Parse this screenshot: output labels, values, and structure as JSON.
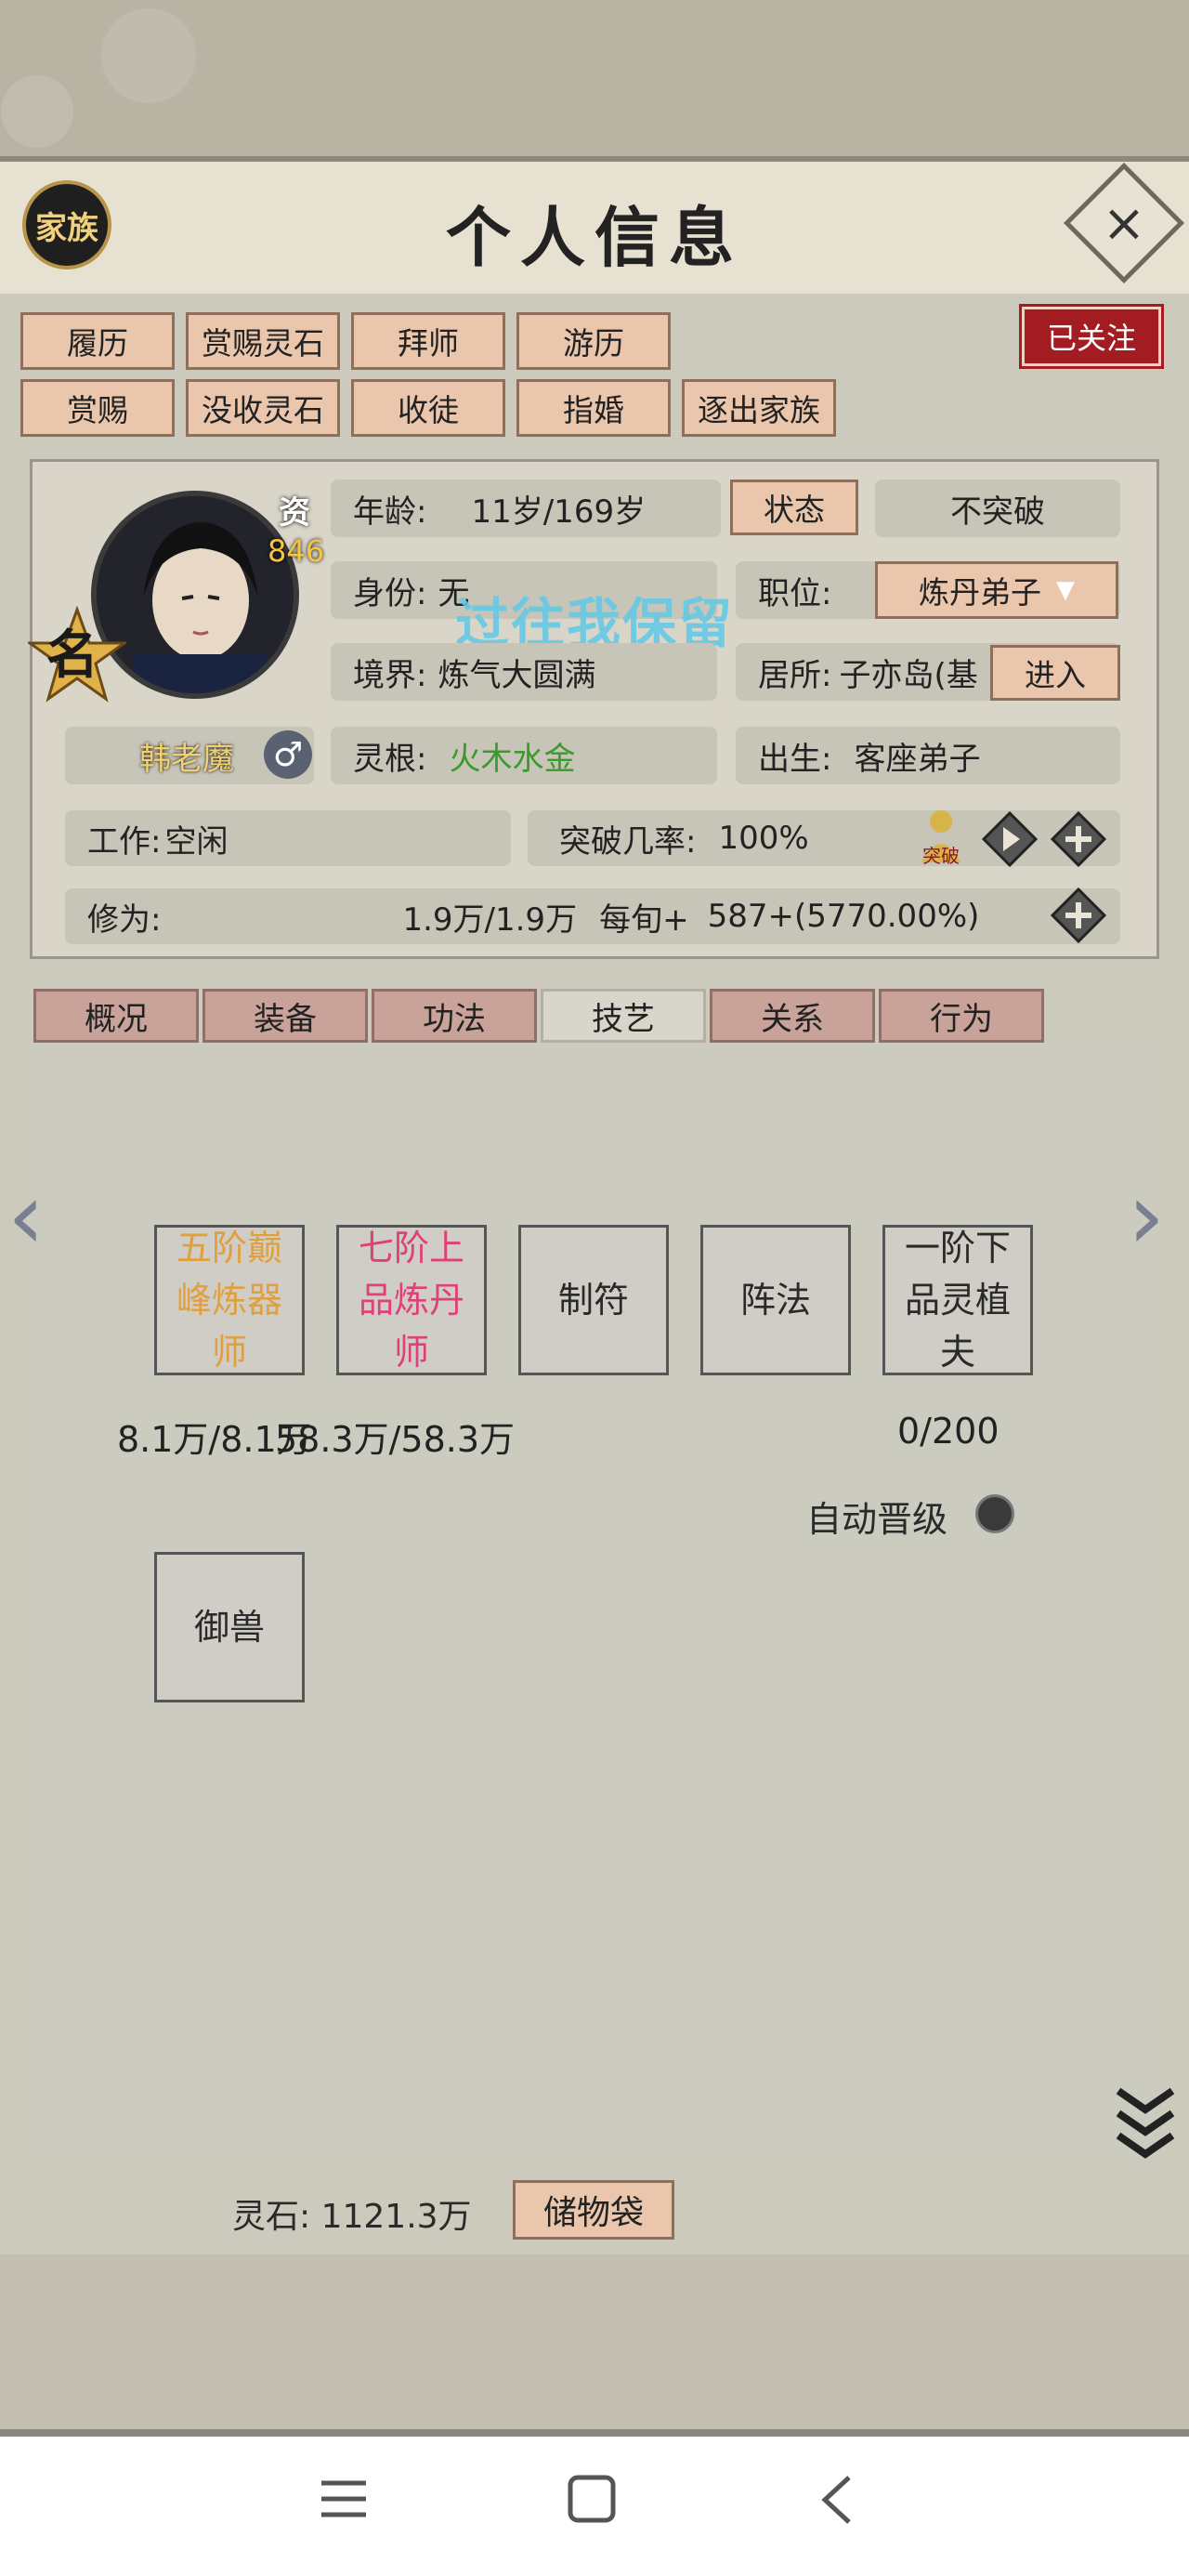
{
  "header": {
    "title": "个人信息",
    "family_label": "家族",
    "close": "×"
  },
  "actions_row1": [
    "履历",
    "赏赐灵石",
    "拜师",
    "游历"
  ],
  "actions_row2": [
    "赏赐",
    "没收灵石",
    "收徒",
    "指婚",
    "逐出家族"
  ],
  "follow_label": "已关注",
  "profile": {
    "aptitude_label": "资",
    "aptitude_value": "846",
    "rank_badge": "名",
    "name": "韩老魔",
    "gender_symbol": "♂",
    "age_label": "年龄:",
    "age_value": "11岁/169岁",
    "status_button": "状态",
    "breakthrough_button": "不突破",
    "identity_label": "身份:",
    "identity_value": "无",
    "watermark": "过往我保留",
    "position_label": "职位:",
    "position_value": "炼丹弟子",
    "realm_label": "境界:",
    "realm_value": "炼气大圆满",
    "residence_label": "居所:",
    "residence_value": "子亦岛(基",
    "enter_button": "进入",
    "root_label": "灵根:",
    "root_value": "火木水金",
    "birth_label": "出生:",
    "birth_value": "客座弟子",
    "work_label": "工作:",
    "work_value": "空闲",
    "break_rate_label": "突破几率:",
    "break_rate_value": "100%",
    "break_icon_text": "突破",
    "cultivation_label": "修为:",
    "cultivation_value": "1.9万/1.9万",
    "per_round_label": "每旬+",
    "per_round_value": "587+(5770.00%)"
  },
  "tabs": [
    "概况",
    "装备",
    "功法",
    "技艺",
    "关系",
    "行为"
  ],
  "active_tab": "技艺",
  "skills": [
    {
      "label": "五阶巅峰炼器师",
      "lines": [
        "五阶巅",
        "峰炼器",
        "师"
      ],
      "color": "#e0a040"
    },
    {
      "label": "七阶上品炼丹师",
      "lines": [
        "七阶上",
        "品炼丹",
        "师"
      ],
      "color": "#e0407a"
    },
    {
      "label": "制符",
      "lines": [
        "制符"
      ],
      "color": "#222222"
    },
    {
      "label": "阵法",
      "lines": [
        "阵法"
      ],
      "color": "#222222"
    },
    {
      "label": "一阶下品灵植夫",
      "lines": [
        "一阶下",
        "品灵植",
        "夫"
      ],
      "color": "#222222"
    },
    {
      "label": "御兽",
      "lines": [
        "御兽"
      ],
      "color": "#222222"
    }
  ],
  "skill_progress": [
    "8.1万/8.1万",
    "58.3万/58.3万",
    "0/200"
  ],
  "auto_promote_label": "自动晋级",
  "footer": {
    "spirit_stone_label": "灵石:",
    "spirit_stone_value": "1121.3万",
    "storage_button": "储物袋"
  }
}
